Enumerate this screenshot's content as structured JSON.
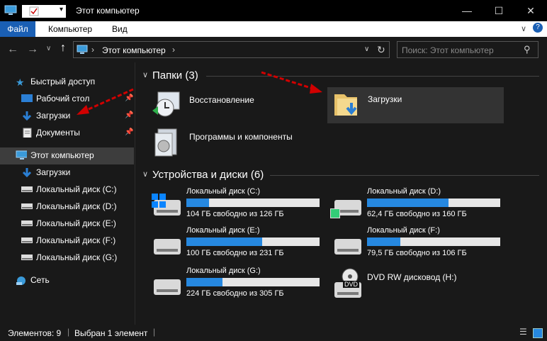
{
  "window": {
    "title": "Этот компьютер"
  },
  "ribbon": {
    "tabs": [
      "Файл",
      "Компьютер",
      "Вид"
    ]
  },
  "address": {
    "path": "Этот компьютер",
    "search_placeholder": "Поиск: Этот компьютер"
  },
  "sidebar": {
    "items": [
      {
        "label": "Быстрый доступ",
        "icon": "star-icon",
        "pinned": false
      },
      {
        "label": "Рабочий стол",
        "icon": "desktop-icon",
        "pinned": true
      },
      {
        "label": "Загрузки",
        "icon": "download-icon",
        "pinned": true
      },
      {
        "label": "Документы",
        "icon": "documents-icon",
        "pinned": true
      },
      {
        "label": "Этот компьютер",
        "icon": "computer-icon",
        "selected": true
      },
      {
        "label": "Загрузки",
        "icon": "download-icon"
      },
      {
        "label": "Локальный диск (C:)",
        "icon": "drive-icon"
      },
      {
        "label": "Локальный диск (D:)",
        "icon": "drive-icon"
      },
      {
        "label": "Локальный диск (E:)",
        "icon": "drive-icon"
      },
      {
        "label": "Локальный диск (F:)",
        "icon": "drive-icon"
      },
      {
        "label": "Локальный диск (G:)",
        "icon": "drive-icon"
      },
      {
        "label": "Сеть",
        "icon": "network-icon"
      }
    ]
  },
  "folders": {
    "header": "Папки (3)",
    "items": [
      {
        "label": "Восстановление",
        "icon": "recovery-icon"
      },
      {
        "label": "Загрузки",
        "icon": "downloads-folder-icon",
        "selected": true
      },
      {
        "label": "Программы и компоненты",
        "icon": "programs-icon"
      }
    ]
  },
  "devices": {
    "header": "Устройства и диски (6)",
    "items": [
      {
        "label": "Локальный диск (C:)",
        "free": "104 ГБ свободно из 126 ГБ",
        "used_fraction": 0.17
      },
      {
        "label": "Локальный диск (D:)",
        "free": "62,4 ГБ свободно из 160 ГБ",
        "used_fraction": 0.61
      },
      {
        "label": "Локальный диск (E:)",
        "free": "100 ГБ свободно из 231 ГБ",
        "used_fraction": 0.57
      },
      {
        "label": "Локальный диск (F:)",
        "free": "79,5 ГБ свободно из 106 ГБ",
        "used_fraction": 0.25
      },
      {
        "label": "Локальный диск (G:)",
        "free": "224 ГБ свободно из 305 ГБ",
        "used_fraction": 0.27
      },
      {
        "label": "DVD RW дисковод (H:)",
        "dvd_badge": "DVD"
      }
    ]
  },
  "status": {
    "items_count": "Элементов: 9",
    "selected": "Выбран 1 элемент"
  },
  "colors": {
    "accent": "#2688e0",
    "bg": "#191919",
    "file_tab": "#1a5fb4",
    "annotation": "#d10000"
  }
}
